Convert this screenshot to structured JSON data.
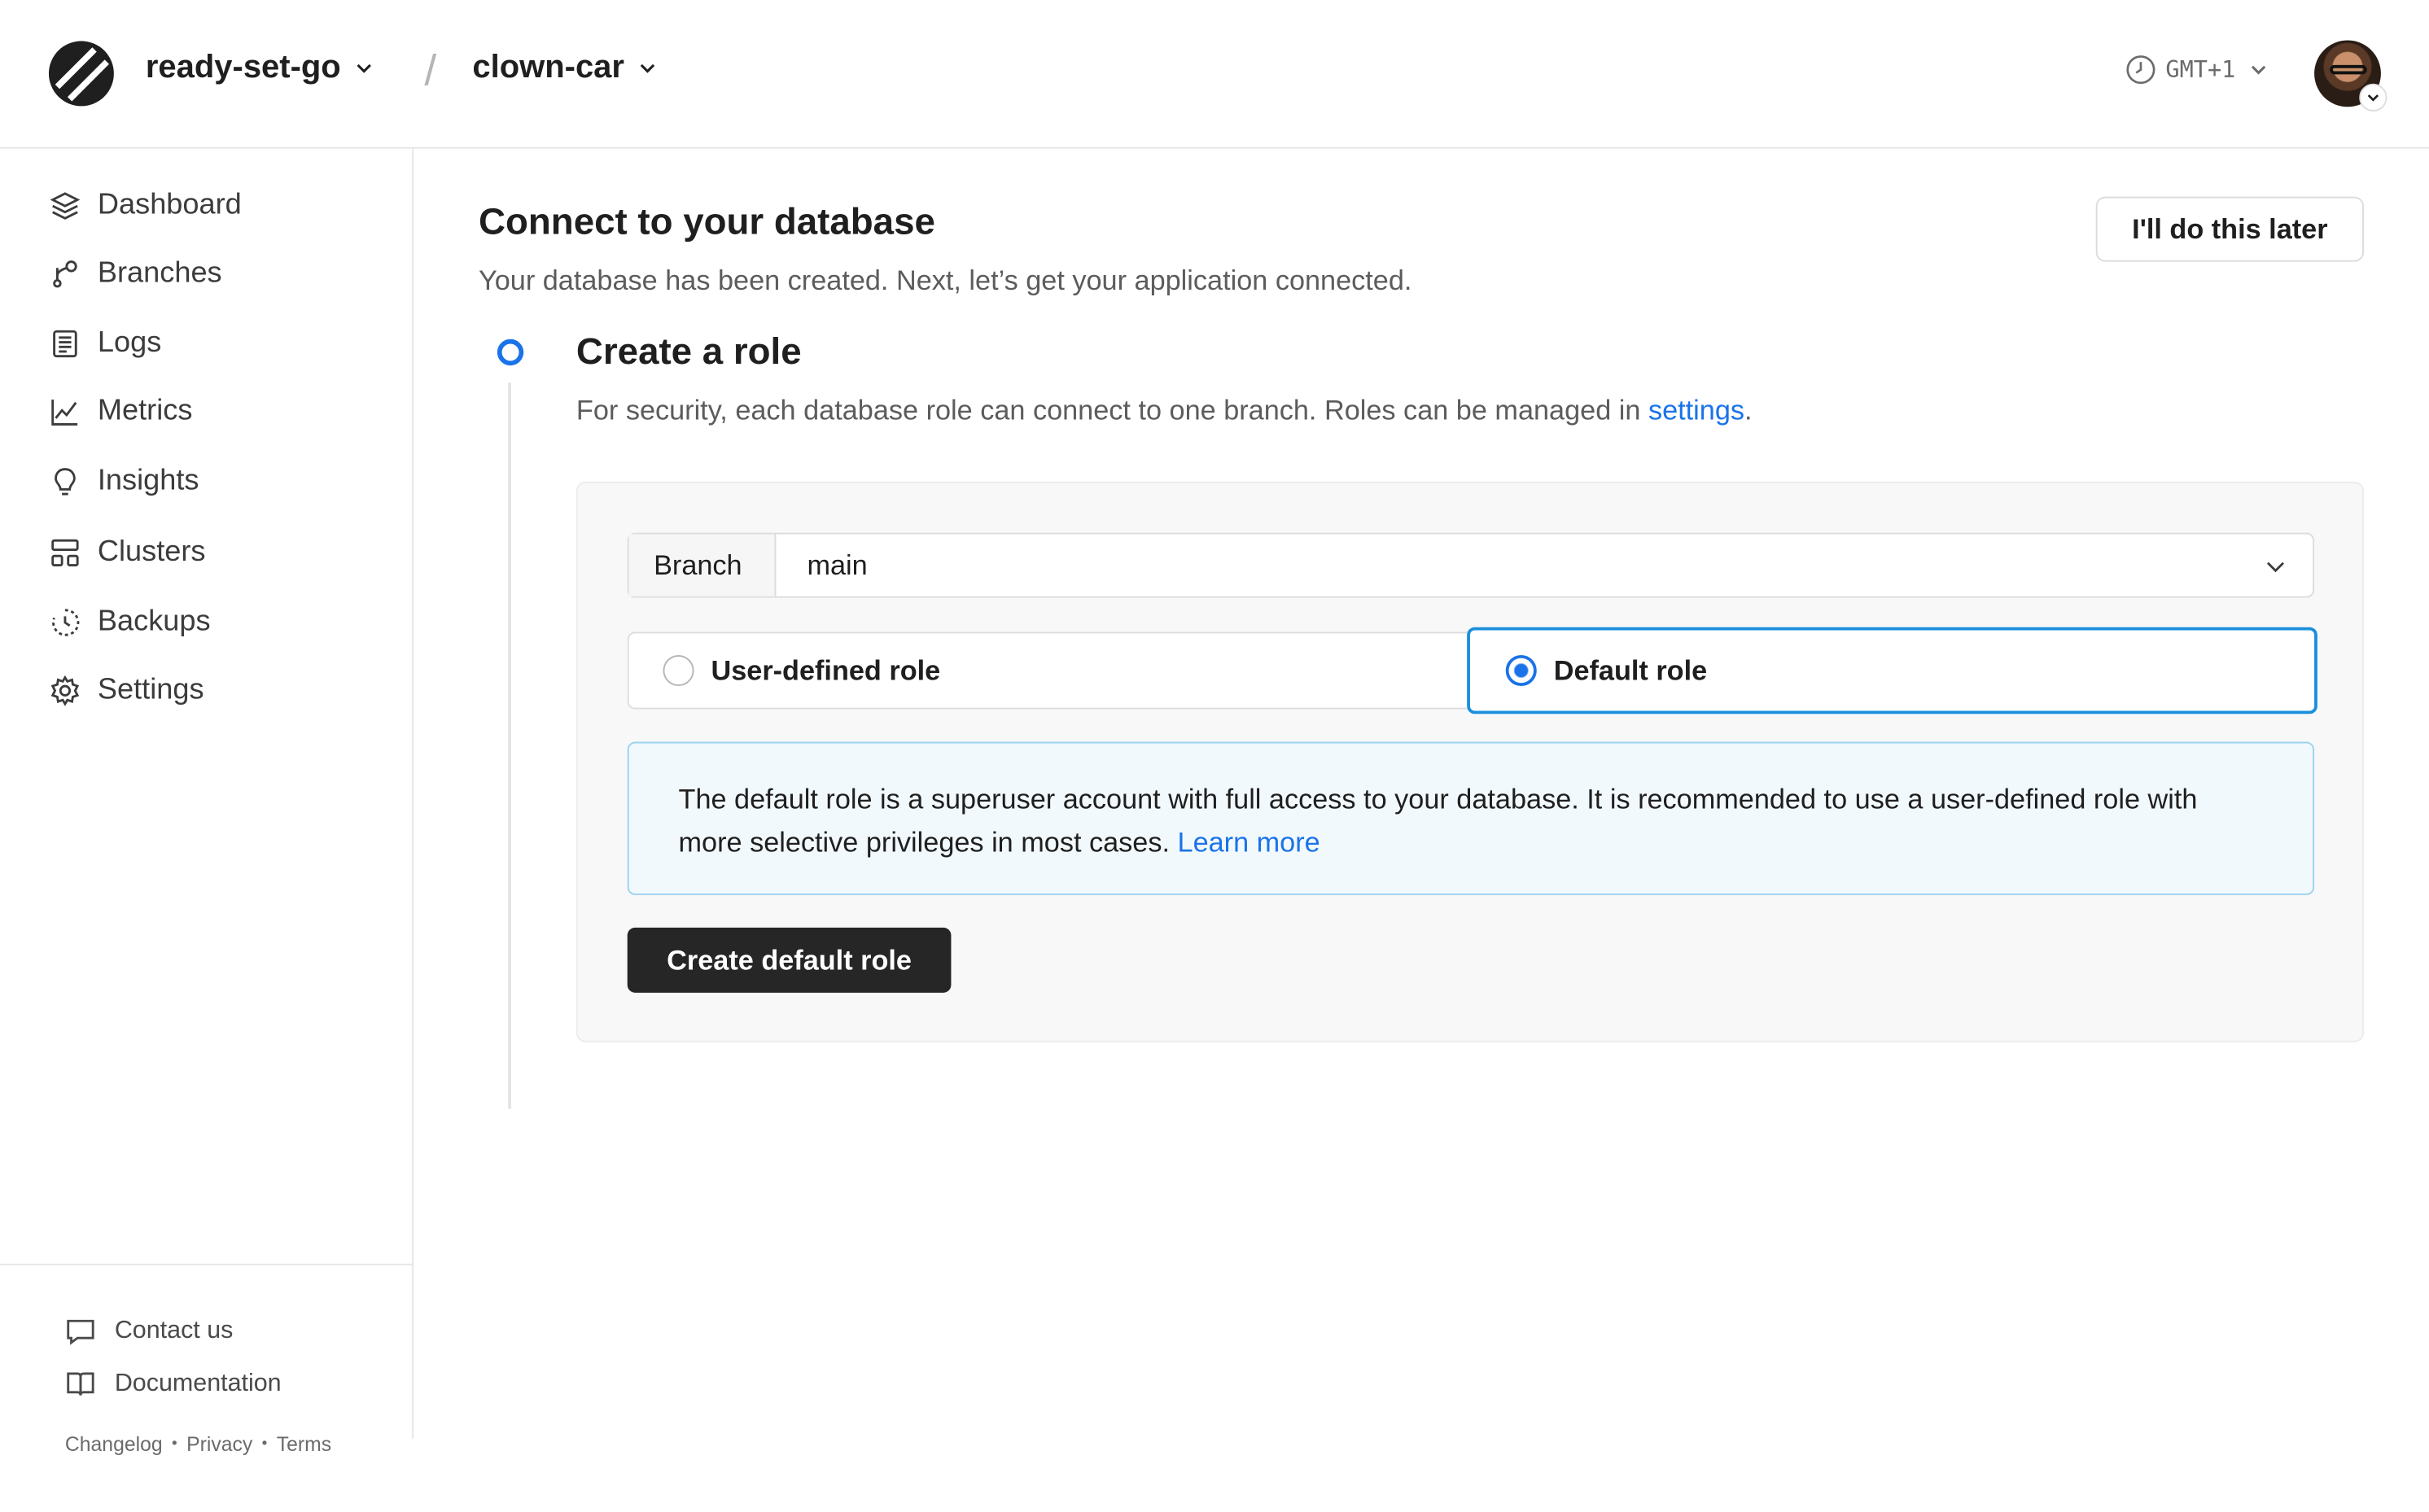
{
  "header": {
    "org_name": "ready-set-go",
    "separator": "/",
    "db_name": "clown-car",
    "timezone": "GMT+1"
  },
  "sidebar": {
    "items": [
      {
        "label": "Dashboard",
        "icon": "layers-icon"
      },
      {
        "label": "Branches",
        "icon": "branch-icon"
      },
      {
        "label": "Logs",
        "icon": "logs-icon"
      },
      {
        "label": "Metrics",
        "icon": "chart-icon"
      },
      {
        "label": "Insights",
        "icon": "lightbulb-icon"
      },
      {
        "label": "Clusters",
        "icon": "clusters-icon"
      },
      {
        "label": "Backups",
        "icon": "backup-icon"
      },
      {
        "label": "Settings",
        "icon": "gear-icon"
      }
    ],
    "footer": {
      "contact": "Contact us",
      "docs": "Documentation",
      "changelog": "Changelog",
      "privacy": "Privacy",
      "terms": "Terms",
      "dot": "•"
    }
  },
  "main": {
    "title": "Connect to your database",
    "subtitle": "Your database has been created. Next, let’s get your application connected.",
    "later_button": "I'll do this later",
    "step": {
      "title": "Create a role",
      "desc_prefix": "For security, each database role can connect to one branch. Roles can be managed in ",
      "desc_link": "settings",
      "desc_suffix": "."
    },
    "branch": {
      "label": "Branch",
      "value": "main"
    },
    "roles": {
      "user_defined": "User-defined role",
      "default": "Default role",
      "selected": "Default role"
    },
    "info": {
      "text": "The default role is a superuser account with full access to your database. It is recommended to use a user-defined role with more selective privileges in most cases. ",
      "link": "Learn more"
    },
    "create_button": "Create default role"
  },
  "colors": {
    "accent": "#1a73e8",
    "selected_border": "#1a8fdb",
    "info_bg": "#f2f9fd",
    "primary_button": "#262626"
  }
}
